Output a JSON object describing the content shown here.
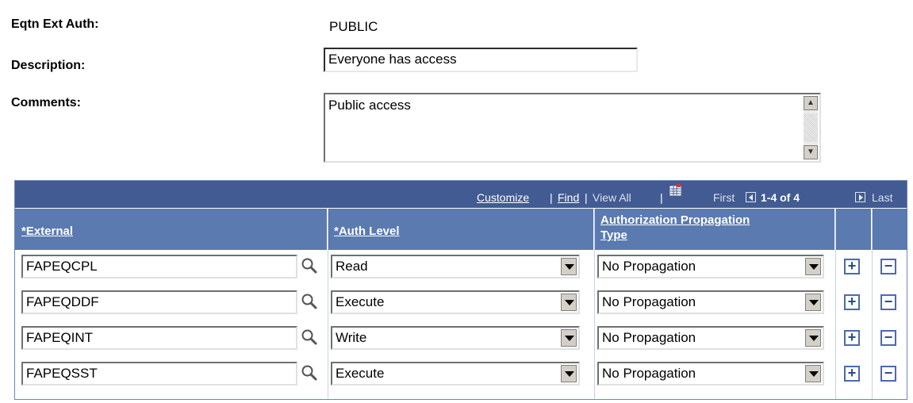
{
  "form": {
    "eqtn_label": "Eqtn Ext Auth:",
    "eqtn_value": "PUBLIC",
    "description_label": "Description:",
    "description_value": "Everyone has access",
    "comments_label": "Comments:",
    "comments_value": "Public access"
  },
  "grid": {
    "nav": {
      "customize": "Customize",
      "sep1": "|",
      "find": "Find",
      "sep2": "|",
      "view_all": "View All",
      "sep3": "|",
      "first": "First",
      "range": "1-4 of 4",
      "last": "Last"
    },
    "headers": {
      "external": "*External",
      "auth_level": "*Auth Level",
      "propagation_line1": "Authorization Propagation",
      "propagation_line2": "Type"
    },
    "rows": [
      {
        "external": "FAPEQCPL",
        "auth_level": "Read",
        "propagation": "No Propagation"
      },
      {
        "external": "FAPEQDDF",
        "auth_level": "Execute",
        "propagation": "No Propagation"
      },
      {
        "external": "FAPEQINT",
        "auth_level": "Write",
        "propagation": "No Propagation"
      },
      {
        "external": "FAPEQSST",
        "auth_level": "Execute",
        "propagation": "No Propagation"
      }
    ],
    "add_symbol": "+",
    "remove_symbol": "−"
  },
  "colors": {
    "nav_bar": "#425b92",
    "header": "#5a7ab0",
    "button_border": "#4a6bab"
  }
}
